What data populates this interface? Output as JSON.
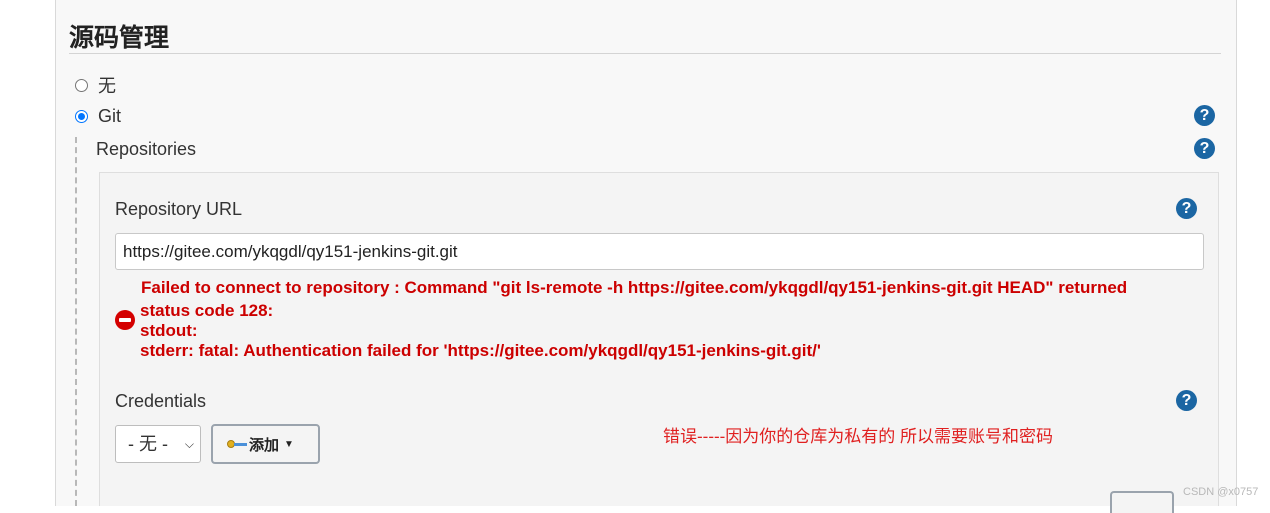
{
  "section": {
    "title": "源码管理"
  },
  "scm_options": [
    {
      "label": "无",
      "checked": false
    },
    {
      "label": "Git",
      "checked": true
    }
  ],
  "repositories": {
    "label": "Repositories",
    "repository_url": {
      "label": "Repository URL",
      "value": "https://gitee.com/ykqgdl/qy151-jenkins-git.git"
    },
    "error": {
      "line1": "Failed to connect to repository : Command \"git ls-remote -h https://gitee.com/ykqgdl/qy151-jenkins-git.git HEAD\" returned",
      "line2": "status code 128:",
      "line3": "stdout:",
      "line4": "stderr: fatal: Authentication failed for 'https://gitee.com/ykqgdl/qy151-jenkins-git.git/'"
    },
    "credentials": {
      "label": "Credentials",
      "selected": "- 无 -",
      "add_button": "添加"
    }
  },
  "annotation": "错误-----因为你的仓库为私有的 所以需要账号和密码",
  "help_glyph": "?",
  "watermark": "CSDN @x0757",
  "colors": {
    "error": "#cc0000",
    "help": "#1b66a3",
    "annotation": "#e02020"
  }
}
